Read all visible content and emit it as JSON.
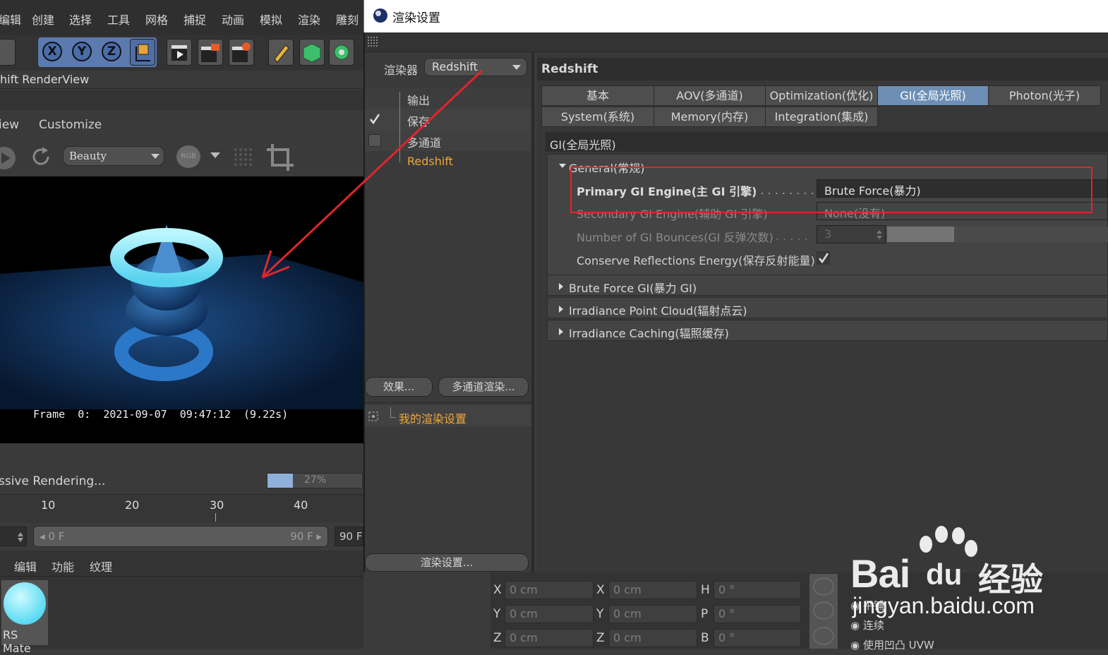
{
  "main_menu": [
    "编辑",
    "创建",
    "选择",
    "工具",
    "网格",
    "捕捉",
    "动画",
    "模拟",
    "渲染",
    "雕刻"
  ],
  "axis_buttons": [
    "X",
    "Y",
    "Z"
  ],
  "renderview": {
    "title": "hift RenderView",
    "menu": [
      "iew",
      "Customize"
    ],
    "aov_select": "Beauty",
    "rgb_label": "RGB",
    "frame_info": "Frame  0:  2021-09-07  09:47:12  (9.22s)",
    "progress_label": "ssive Rendering...",
    "progress_text": "27%",
    "progress_fraction": 0.27
  },
  "timeline": {
    "ticks": [
      "10",
      "20",
      "30",
      "40"
    ],
    "start_frame": "0 F",
    "end_frame": "90 F",
    "right_frame": "90 F"
  },
  "material_manager": {
    "menu": [
      "编辑",
      "功能",
      "纹理"
    ],
    "material_name": "RS Mate"
  },
  "dialog": {
    "title": "渲染设置",
    "renderer_label": "渲染器",
    "renderer_value": "Redshift",
    "tree": [
      {
        "label": "输出",
        "checked": false
      },
      {
        "label": "保存",
        "checked": true
      },
      {
        "label": "多通道",
        "checked": false
      },
      {
        "label": "Redshift",
        "checked": false
      }
    ],
    "effects_button": "效果...",
    "multipass_button": "多通道渲染...",
    "preset_name": "我的渲染设置",
    "render_settings_button": "渲染设置...",
    "panel_header": "Redshift",
    "tabs_row1": [
      "基本",
      "AOV(多通道)",
      "Optimization(优化)",
      "GI(全局光照)",
      "Photon(光子)"
    ],
    "tabs_row2": [
      "System(系统)",
      "Memory(内存)",
      "Integration(集成)"
    ],
    "active_tab": "GI(全局光照)",
    "section_title": "GI(全局光照)",
    "general_group": "General(常规)",
    "params": {
      "primary_label": "Primary GI Engine(主 GI 引擎)",
      "primary_value": "Brute Force(暴力)",
      "secondary_label": "Secondary GI Engine(辅助 GI 引擎)",
      "secondary_value": "None(没有)",
      "bounces_label": "Number of GI Bounces(GI 反弹次数)",
      "bounces_value": "3",
      "conserve_label": "Conserve Reflections Energy(保存反射能量)"
    },
    "collapsed_groups": [
      "Brute Force GI(暴力 GI)",
      "Irradiance Point Cloud(辐射点云)",
      "Irradiance Caching(辐照缓存)"
    ]
  },
  "coordinates": {
    "rows": [
      {
        "a": "X",
        "b": "X",
        "c": "H",
        "v1": "0 cm",
        "v2": "0 cm",
        "v3": "0 °"
      },
      {
        "a": "Y",
        "b": "Y",
        "c": "P",
        "v1": "0 cm",
        "v2": "0 cm",
        "v3": "0 °"
      },
      {
        "a": "Z",
        "b": "Z",
        "c": "B",
        "v1": "0 cm",
        "v2": "0 cm",
        "v3": "0 °"
      }
    ],
    "options": [
      "平铺",
      "连续",
      "使用凹凸 UVW"
    ]
  },
  "watermark": {
    "brand_a": "Bai",
    "brand_b": "du",
    "brand_cn": "经验",
    "url": "jingyan.baidu.com"
  },
  "colors": {
    "accent_tab": "#6d8fb5",
    "highlight_orange": "#f0a838",
    "annotation_red": "#e0262b"
  }
}
